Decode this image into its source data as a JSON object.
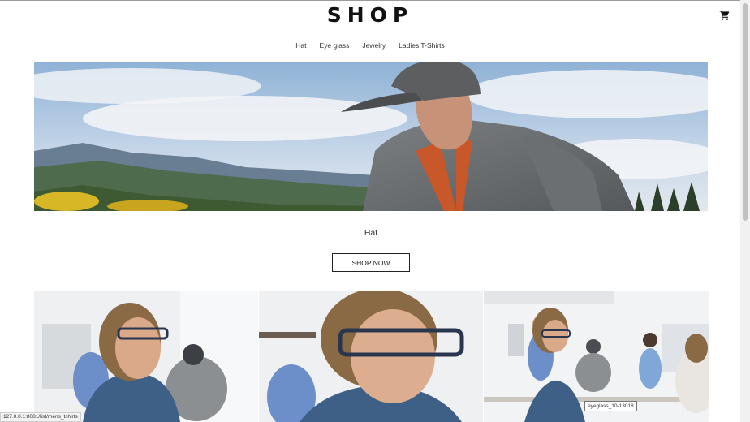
{
  "brand": {
    "logo": "SHOP"
  },
  "header": {
    "cart_icon": "cart-icon"
  },
  "nav": {
    "items": [
      {
        "label": "Hat"
      },
      {
        "label": "Eye glass"
      },
      {
        "label": "Jewelry"
      },
      {
        "label": "Ladies T-Shirts"
      }
    ]
  },
  "hero": {
    "caption": "Hat",
    "button_label": "SHOP NOW"
  },
  "status": {
    "url": "127.0.0.1:8081/list/mens_tshirts",
    "tooltip": "eyeglass_10-13018"
  },
  "colors": {
    "sky": "#9ebcd9",
    "text": "#222222",
    "jacket": "#6d7174",
    "accent": "#c8572a"
  }
}
